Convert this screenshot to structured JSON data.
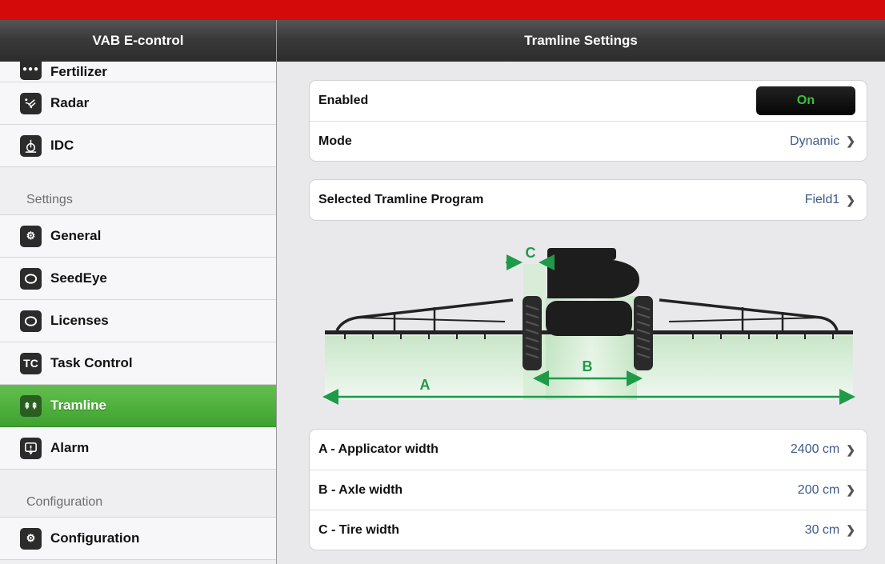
{
  "sidebar": {
    "title": "VAB E-control",
    "items_top": [
      {
        "label": "Fertilizer",
        "icon": "dots-icon"
      },
      {
        "label": "Radar",
        "icon": "radar-icon"
      },
      {
        "label": "IDC",
        "icon": "idc-icon"
      }
    ],
    "section_settings": "Settings",
    "items_settings": [
      {
        "label": "General",
        "icon": "gears-icon"
      },
      {
        "label": "SeedEye",
        "icon": "ring-icon"
      },
      {
        "label": "Licenses",
        "icon": "ring-icon"
      },
      {
        "label": "Task Control",
        "icon": "tc-icon",
        "glyph": "TC"
      },
      {
        "label": "Tramline",
        "icon": "tramline-icon",
        "active": true
      },
      {
        "label": "Alarm",
        "icon": "alarm-icon"
      }
    ],
    "section_configuration": "Configuration",
    "items_configuration": [
      {
        "label": "Configuration",
        "icon": "gears-icon"
      }
    ]
  },
  "main": {
    "title": "Tramline Settings",
    "enabled_label": "Enabled",
    "enabled_value": "On",
    "mode_label": "Mode",
    "mode_value": "Dynamic",
    "program_label": "Selected Tramline Program",
    "program_value": "Field1",
    "diagram": {
      "label_a": "A",
      "label_b": "B",
      "label_c": "C"
    },
    "applicator_label": "A - Applicator width",
    "applicator_value": "2400 cm",
    "axle_label": "B - Axle width",
    "axle_value": "200 cm",
    "tire_label": "C - Tire width",
    "tire_value": "30 cm"
  },
  "colors": {
    "brand_red": "#d40a0a",
    "active_green": "#4caf3c",
    "value_blue": "#3d5a8a",
    "diagram_green": "#1f9a48"
  }
}
